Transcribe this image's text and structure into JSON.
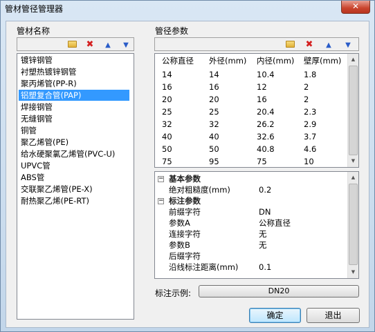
{
  "window": {
    "title": "管材管径管理器",
    "close_label": "✕"
  },
  "left_panel": {
    "label": "管材名称",
    "toolbar": {
      "folder_icon": "folder-icon",
      "delete_icon": "delete-icon",
      "up_icon": "arrow-up-icon",
      "down_icon": "arrow-down-icon"
    },
    "items": [
      "镀锌钢管",
      "衬塑热镀锌钢管",
      "聚丙烯管(PP-R)",
      "铝塑复合管(PAP)",
      "焊接钢管",
      "无缝钢管",
      "铜管",
      "聚乙烯管(PE)",
      "给水硬聚氯乙烯管(PVC-U)",
      "UPVC管",
      "ABS管",
      "交联聚乙烯管(PE-X)",
      "耐热聚乙烯(PE-RT)"
    ],
    "selected_index": 3
  },
  "right_panel": {
    "label": "管径参数",
    "table": {
      "headers": [
        "公称直径",
        "外径(mm)",
        "内径(mm)",
        "壁厚(mm)"
      ],
      "rows": [
        [
          "14",
          "14",
          "10.4",
          "1.8"
        ],
        [
          "16",
          "16",
          "12",
          "2"
        ],
        [
          "20",
          "20",
          "16",
          "2"
        ],
        [
          "25",
          "25",
          "20.4",
          "2.3"
        ],
        [
          "32",
          "32",
          "26.2",
          "2.9"
        ],
        [
          "40",
          "40",
          "32.6",
          "3.7"
        ],
        [
          "50",
          "50",
          "40.8",
          "4.6"
        ],
        [
          "75",
          "95",
          "75",
          "10"
        ]
      ]
    },
    "properties": {
      "basic": {
        "title": "基本参数",
        "rows": [
          {
            "name": "绝对粗糙度(mm)",
            "value": "0.2"
          }
        ]
      },
      "annotation": {
        "title": "标注参数",
        "rows": [
          {
            "name": "前缀字符",
            "value": "DN"
          },
          {
            "name": "参数A",
            "value": "公称直径"
          },
          {
            "name": "连接字符",
            "value": "无"
          },
          {
            "name": "参数B",
            "value": "无"
          },
          {
            "name": "后缀字符",
            "value": ""
          },
          {
            "name": "沿线标注距离(mm)",
            "value": "0.1"
          }
        ]
      }
    },
    "example_label": "标注示例:",
    "example_value": "DN20"
  },
  "buttons": {
    "ok": "确定",
    "exit": "退出"
  }
}
